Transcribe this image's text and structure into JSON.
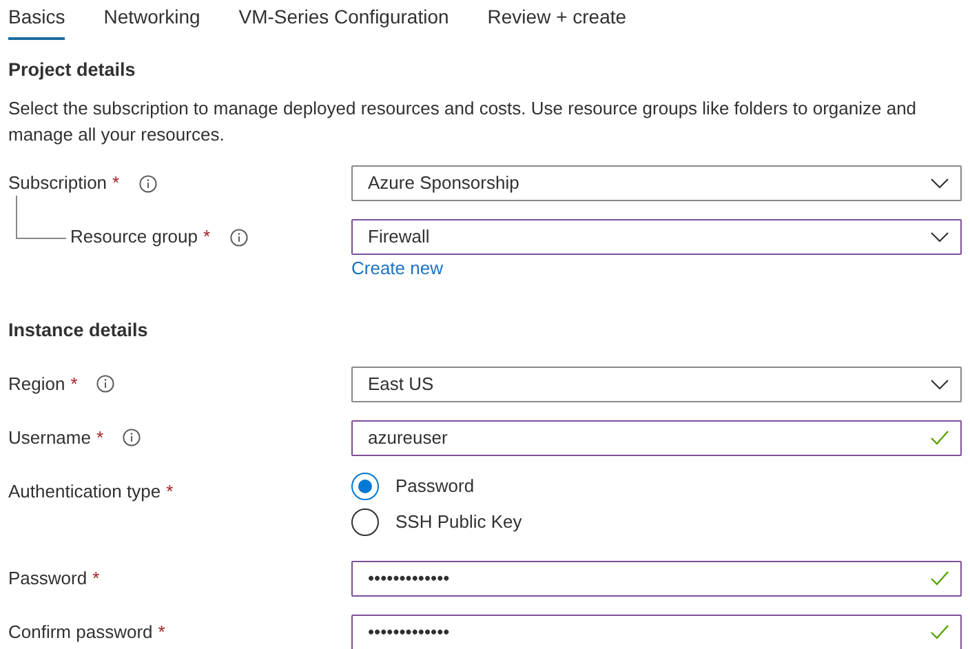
{
  "tabs": [
    {
      "label": "Basics",
      "selected": true
    },
    {
      "label": "Networking",
      "selected": false
    },
    {
      "label": "VM-Series Configuration",
      "selected": false
    },
    {
      "label": "Review + create",
      "selected": false
    }
  ],
  "sections": [
    {
      "title": "Project details",
      "description": "Select the subscription to manage deployed resources and costs. Use resource groups like folders to organize and manage all your resources.",
      "fields": [
        {
          "kind": "select",
          "label": "Subscription",
          "required_mark": "*",
          "info": true,
          "nested": false,
          "value": "Azure Sponsorship",
          "highlighted": false
        },
        {
          "kind": "select",
          "label": "Resource group",
          "required_mark": "*",
          "info": true,
          "nested": true,
          "value": "Firewall",
          "highlighted": true,
          "link": "Create new"
        }
      ]
    },
    {
      "title": "Instance details",
      "fields": [
        {
          "kind": "select",
          "label": "Region",
          "required_mark": "*",
          "info": true,
          "nested": false,
          "value": "East US",
          "highlighted": false
        },
        {
          "kind": "text",
          "label": "Username",
          "required_mark": "*",
          "info": true,
          "nested": false,
          "value": "azureuser",
          "highlighted": true,
          "valid": true
        },
        {
          "kind": "radio",
          "label": "Authentication type",
          "required_mark": "*",
          "info": false,
          "nested": false,
          "options": [
            {
              "label": "Password",
              "selected": true
            },
            {
              "label": "SSH Public Key",
              "selected": false
            }
          ]
        },
        {
          "kind": "text",
          "label": "Password",
          "required_mark": "*",
          "info": false,
          "nested": false,
          "value": "•••••••••••••",
          "highlighted": true,
          "valid": true
        },
        {
          "kind": "text",
          "label": "Confirm password",
          "required_mark": "*",
          "info": false,
          "nested": false,
          "value": "•••••••••••••",
          "highlighted": true,
          "valid": true
        }
      ]
    }
  ]
}
